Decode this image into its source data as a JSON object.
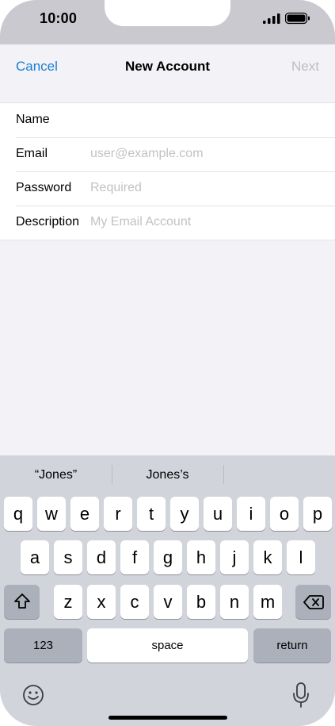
{
  "status_bar": {
    "time": "10:00",
    "icons": [
      "signal-icon",
      "battery-icon"
    ]
  },
  "nav": {
    "cancel_label": "Cancel",
    "title": "New Account",
    "next_label": "Next"
  },
  "form": {
    "fields": [
      {
        "label": "Name",
        "value": "",
        "placeholder": ""
      },
      {
        "label": "Email",
        "value": "",
        "placeholder": "user@example.com"
      },
      {
        "label": "Password",
        "value": "",
        "placeholder": "Required"
      },
      {
        "label": "Description",
        "value": "",
        "placeholder": "My Email Account"
      }
    ]
  },
  "keyboard": {
    "suggestions": [
      "“Jones”",
      "Jones’s",
      ""
    ],
    "row1": [
      "q",
      "w",
      "e",
      "r",
      "t",
      "y",
      "u",
      "i",
      "o",
      "p"
    ],
    "row2": [
      "a",
      "s",
      "d",
      "f",
      "g",
      "h",
      "j",
      "k",
      "l"
    ],
    "row3": [
      "z",
      "x",
      "c",
      "v",
      "b",
      "n",
      "m"
    ],
    "numbers_label": "123",
    "space_label": "space",
    "return_label": "return",
    "icons": [
      "shift-icon",
      "backspace-icon",
      "emoji-icon",
      "mic-icon"
    ]
  },
  "colors": {
    "accent": "#1a7fd1",
    "disabled": "#bdbdc2",
    "keyboard_bg": "#d1d4db",
    "key_dark": "#abb0bb"
  }
}
